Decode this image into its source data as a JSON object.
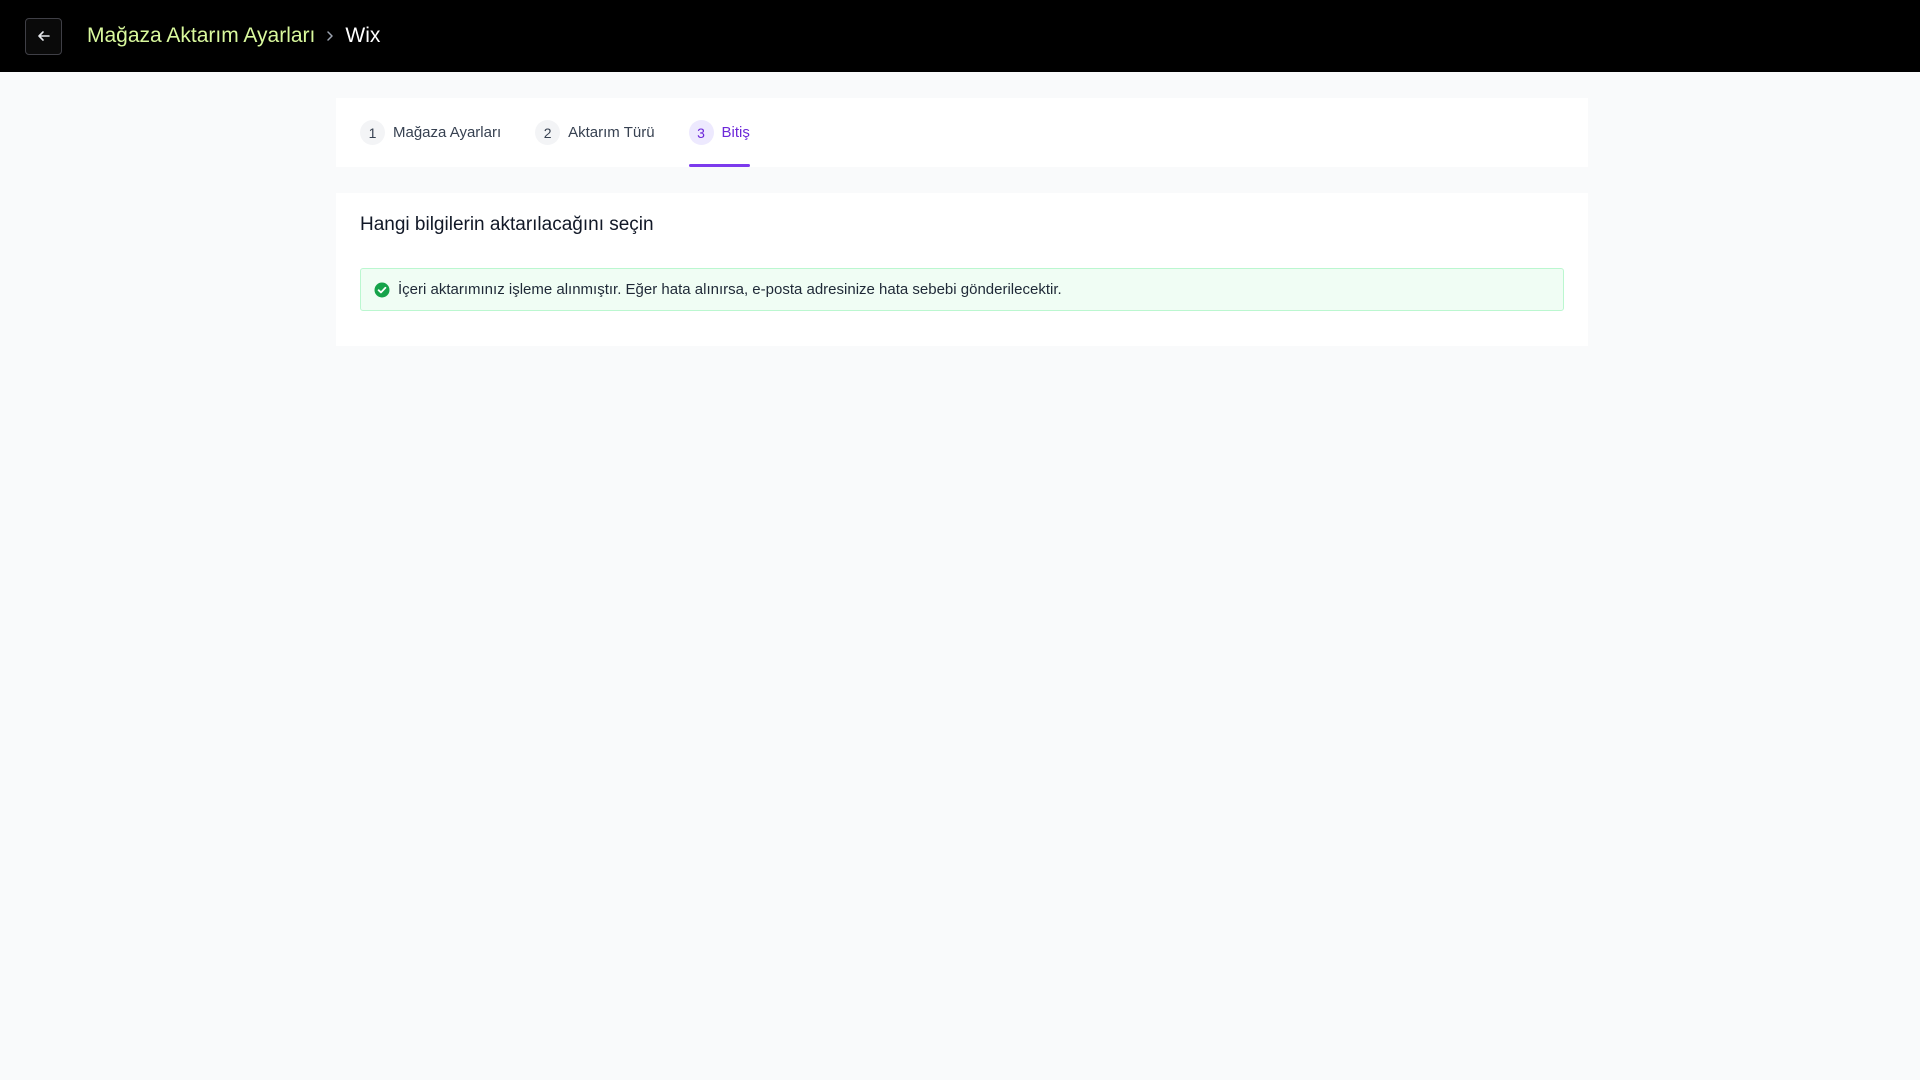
{
  "header": {
    "back_icon": "arrow-left-icon",
    "breadcrumb_parent": "Mağaza Aktarım Ayarları",
    "breadcrumb_separator_icon": "chevron-right-icon",
    "breadcrumb_current": "Wix"
  },
  "steps": [
    {
      "number": "1",
      "label": "Mağaza Ayarları",
      "active": false
    },
    {
      "number": "2",
      "label": "Aktarım Türü",
      "active": false
    },
    {
      "number": "3",
      "label": "Bitiş",
      "active": true
    }
  ],
  "content": {
    "title": "Hangi bilgilerin aktarılacağını seçin",
    "alert_icon": "check-circle-icon",
    "alert_text": "İçeri aktarımınız işleme alınmıştır. Eğer hata alınırsa, e-posta adresinize hata sebebi gönderilecektir."
  },
  "colors": {
    "header_bg": "#000000",
    "breadcrumb_link": "#d9f99d",
    "accent": "#7c3aed",
    "success": "#16a34a",
    "success_bg": "#f0fdf4",
    "page_bg": "#f9fafb"
  }
}
